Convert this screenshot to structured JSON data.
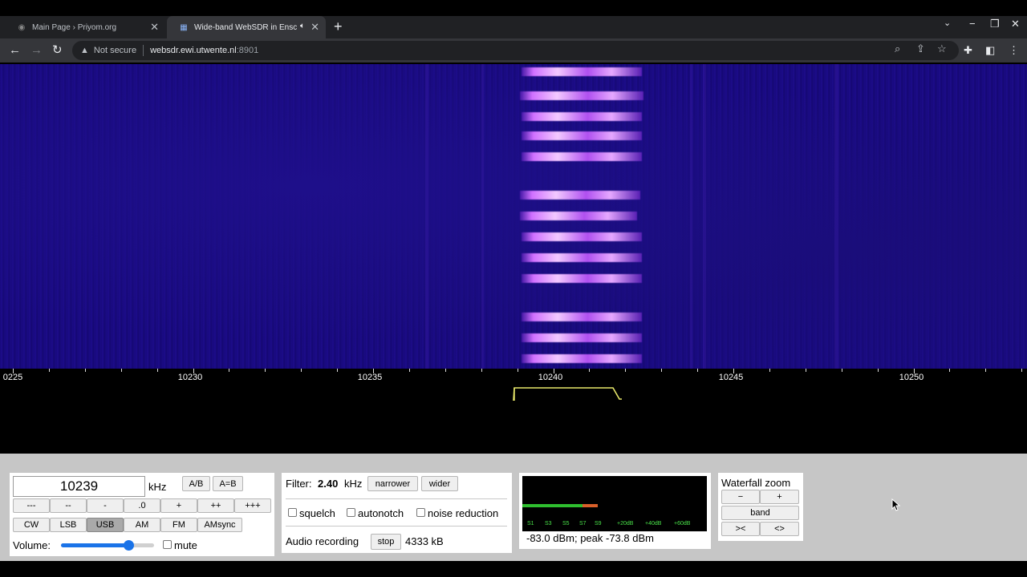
{
  "browser": {
    "tabs": [
      {
        "title": "Main Page › Priyom.org",
        "active": false
      },
      {
        "title": "Wide-band WebSDR in Ensche",
        "active": true,
        "audio": true
      }
    ],
    "new_tab_symbol": "+",
    "address": {
      "security_label": "Not secure",
      "host": "websdr.ewi.utwente.nl",
      "port": ":8901"
    }
  },
  "waterfall": {
    "scale_labels": [
      "0225",
      "10230",
      "10235",
      "10240",
      "10245",
      "10250"
    ],
    "colors": {
      "background": "#17097c",
      "signal": "#e6a8ff"
    }
  },
  "controls": {
    "frequency": "10239",
    "freq_unit": "kHz",
    "ab_button": "A/B",
    "a_eq_b_button": "A=B",
    "step_buttons": [
      "---",
      "--",
      "-",
      ".0",
      "+",
      "++",
      "+++"
    ],
    "mode_buttons": [
      "CW",
      "LSB",
      "USB",
      "AM",
      "FM",
      "AMsync"
    ],
    "selected_mode": "USB",
    "volume_label": "Volume:",
    "volume_level": 0.72,
    "mute_label": "mute",
    "mute_checked": false
  },
  "filter": {
    "label": "Filter:",
    "value": "2.40",
    "unit": "kHz",
    "narrower": "narrower",
    "wider": "wider",
    "squelch": "squelch",
    "autonotch": "autonotch",
    "noise_reduction": "noise reduction",
    "audio_recording_label": "Audio recording",
    "stop_button": "stop",
    "recording_size": "4333 kB"
  },
  "smeter": {
    "readout": "-83.0 dBm; peak  -73.8 dBm",
    "scale": [
      "S1",
      "S3",
      "S5",
      "S7",
      "S9",
      "+20dB",
      "+40dB",
      "+60dB"
    ],
    "level": 0.41,
    "peak": 0.41
  },
  "waterfall_zoom": {
    "title": "Waterfall zoom",
    "minus": "−",
    "plus": "+",
    "band": "band",
    "narrow": "><",
    "wide": "<>"
  }
}
